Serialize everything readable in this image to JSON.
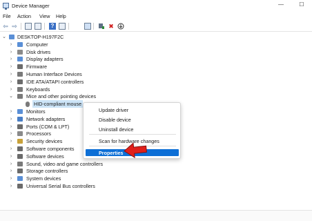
{
  "window": {
    "title": "Device Manager",
    "controls": {
      "minimize": "—",
      "maximize": "☐"
    }
  },
  "menu": [
    "File",
    "Action",
    "View",
    "Help"
  ],
  "toolbar": {
    "icons": [
      "back-arrow-icon",
      "forward-arrow-icon",
      "properties-icon",
      "refresh-icon",
      "help-icon",
      "show-hidden-icon",
      "monitor-icon",
      "update-driver-icon",
      "uninstall-icon",
      "scan-hardware-icon"
    ],
    "uninstall_glyph": "✖",
    "back_glyph": "⇦",
    "forward_glyph": "⇨",
    "help_glyph": "?"
  },
  "tree": {
    "root": "DESKTOP-H197F2C",
    "categories": [
      {
        "label": "Computer",
        "icon": "#5a8fd6"
      },
      {
        "label": "Disk drives",
        "icon": "#8a8a8a"
      },
      {
        "label": "Display adapters",
        "icon": "#5a8fd6"
      },
      {
        "label": "Firmware",
        "icon": "#6b6b6b"
      },
      {
        "label": "Human Interface Devices",
        "icon": "#7a7a7a"
      },
      {
        "label": "IDE ATA/ATAPI controllers",
        "icon": "#6b6b6b"
      },
      {
        "label": "Keyboards",
        "icon": "#7a7a7a"
      },
      {
        "label": "Mice and other pointing devices",
        "icon": "#7a7a7a",
        "expanded": true,
        "children": [
          "HID-compliant mouse"
        ]
      },
      {
        "label": "Monitors",
        "icon": "#5a8fd6"
      },
      {
        "label": "Network adapters",
        "icon": "#4a7fc6"
      },
      {
        "label": "Ports (COM & LPT)",
        "icon": "#6b6b6b"
      },
      {
        "label": "Processors",
        "icon": "#8a8a8a"
      },
      {
        "label": "Security devices",
        "icon": "#c9a23a"
      },
      {
        "label": "Software components",
        "icon": "#6b6b6b"
      },
      {
        "label": "Software devices",
        "icon": "#6b6b6b"
      },
      {
        "label": "Sound, video and game controllers",
        "icon": "#7a7a7a"
      },
      {
        "label": "Storage controllers",
        "icon": "#6b6b6b"
      },
      {
        "label": "System devices",
        "icon": "#5a8fd6"
      },
      {
        "label": "Universal Serial Bus controllers",
        "icon": "#6b6b6b"
      }
    ]
  },
  "context_menu": {
    "items": [
      "Update driver",
      "Disable device",
      "Uninstall device",
      "Scan for hardware changes",
      "Properties"
    ],
    "highlighted": "Properties",
    "highlight_color": "#0d6fd6"
  },
  "annotation": {
    "arrow_color": "#e0201b"
  }
}
